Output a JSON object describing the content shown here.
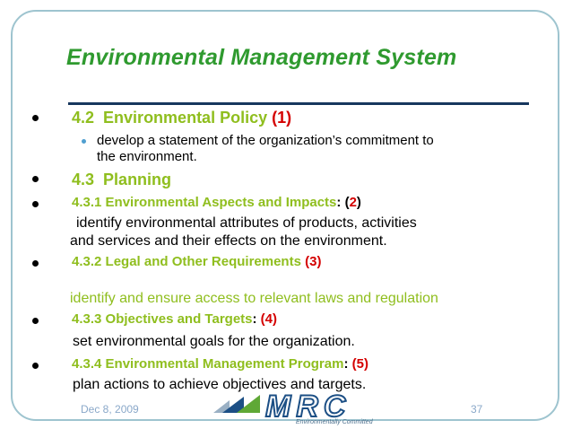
{
  "slide": {
    "title": "Environmental Management System",
    "items": [
      {
        "num": "4.2",
        "label": "Environmental Policy",
        "ref": "(1)"
      },
      {
        "text": "develop a statement of the organization’s commitment to",
        "text2": "the environment."
      },
      {
        "num": "4.3",
        "label": "Planning"
      },
      {
        "num": "4.3.1",
        "label": "Environmental Aspects and Impacts",
        "sep": ":",
        "ref_open": "(",
        "ref_num": "2",
        "ref_close": ")",
        "desc1": "identify environmental attributes of products, activities",
        "desc2": "and services and their effects on the environment."
      },
      {
        "num": "4.3.2",
        "label": "Legal and Other Requirements",
        "ref": "(3)",
        "desc": "identify and ensure access to relevant laws and regulation"
      },
      {
        "num": "4.3.3",
        "label": "Objectives and Targets",
        "sep": ":",
        "ref": "(4)",
        "desc": "set environmental goals for the organization."
      },
      {
        "num": "4.3.4",
        "label": "Environmental Management Program",
        "sep": ":",
        "ref": "(5)",
        "desc": "plan actions to achieve objectives and targets."
      }
    ]
  },
  "footer": {
    "date": "Dec 8, 2009",
    "page": "37",
    "logo_text": "MRC",
    "logo_tagline": "Environmentally Committed"
  },
  "colors": {
    "title": "#2f9a2f",
    "heading": "#8fbe1e",
    "ref": "#d40000",
    "rule": "#17375e",
    "frame": "#9ec4cf",
    "footer": "#8aa8c9"
  }
}
